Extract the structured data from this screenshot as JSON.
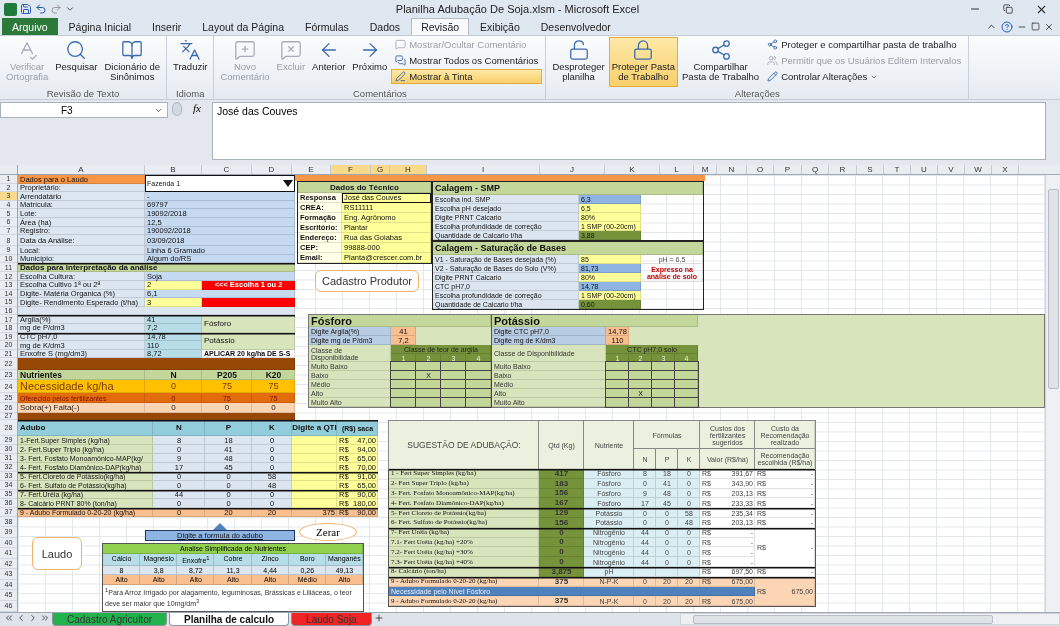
{
  "window": {
    "title": "Planilha Adubação De Soja.xlsm - Microsoft Excel"
  },
  "ribbon_tabs": [
    {
      "label": "Arquivo",
      "kind": "file",
      "selected": false
    },
    {
      "label": "Página Inicial",
      "kind": "tab",
      "selected": false
    },
    {
      "label": "Inserir",
      "kind": "tab",
      "selected": false
    },
    {
      "label": "Layout da Página",
      "kind": "tab",
      "selected": false
    },
    {
      "label": "Fórmulas",
      "kind": "tab",
      "selected": false
    },
    {
      "label": "Dados",
      "kind": "tab",
      "selected": false
    },
    {
      "label": "Revisão",
      "kind": "tab",
      "selected": true
    },
    {
      "label": "Exibição",
      "kind": "tab",
      "selected": false
    },
    {
      "label": "Desenvolvedor",
      "kind": "tab",
      "selected": false
    }
  ],
  "ribbon_groups": [
    {
      "label": "Revisão de Texto",
      "buttons": [
        {
          "label": "Verificar\nOrtografia",
          "disabled": true,
          "selected": false
        },
        {
          "label": "Pesquisar",
          "disabled": false,
          "selected": false
        },
        {
          "label": "Dicionário de\nSinônimos",
          "disabled": false,
          "selected": false
        }
      ]
    },
    {
      "label": "Idioma",
      "buttons": [
        {
          "label": "Traduzir",
          "disabled": false,
          "selected": false
        }
      ]
    },
    {
      "label": "Comentários",
      "buttons": [
        {
          "label": "Novo\nComentário",
          "disabled": true,
          "selected": false
        },
        {
          "label": "Excluir",
          "disabled": true,
          "selected": false
        },
        {
          "label": "Anterior",
          "disabled": false,
          "selected": false
        },
        {
          "label": "Próximo",
          "disabled": false,
          "selected": false
        }
      ],
      "small_buttons": [
        {
          "label": "Mostrar/Ocultar Comentário",
          "disabled": true,
          "selected": false,
          "has_menu": false
        },
        {
          "label": "Mostrar Todos os Comentários",
          "disabled": false,
          "selected": false,
          "has_menu": false
        },
        {
          "label": "Mostrar à Tinta",
          "disabled": false,
          "selected": true,
          "has_menu": false
        }
      ]
    },
    {
      "label": "Alterações",
      "buttons": [
        {
          "label": "Desproteger\nplanilha",
          "disabled": false,
          "selected": false
        },
        {
          "label": "Proteger Pasta\nde Trabalho",
          "disabled": false,
          "selected": true
        },
        {
          "label": "Compartilhar\nPasta de Trabalho",
          "disabled": false,
          "selected": false
        }
      ],
      "small_buttons": [
        {
          "label": "Proteger e compartilhar pasta de trabalho",
          "disabled": false,
          "selected": false,
          "has_menu": false
        },
        {
          "label": "Permitir que os Usuários Editem Intervalos",
          "disabled": true,
          "selected": false,
          "has_menu": false
        },
        {
          "label": "Controlar Alterações",
          "disabled": false,
          "selected": false,
          "has_menu": true
        }
      ]
    }
  ],
  "formula_bar": {
    "name_box": "F3",
    "function_label": "fx",
    "value": "José das Couves"
  },
  "columns": [
    {
      "label": "A",
      "selected": false
    },
    {
      "label": "B",
      "selected": false
    },
    {
      "label": "C",
      "selected": false
    },
    {
      "label": "D",
      "selected": false
    },
    {
      "label": "E",
      "selected": false
    },
    {
      "label": "F",
      "selected": true
    },
    {
      "label": "G",
      "selected": true
    },
    {
      "label": "H",
      "selected": true
    },
    {
      "label": "I",
      "selected": false
    },
    {
      "label": "J",
      "selected": false
    },
    {
      "label": "K",
      "selected": false
    },
    {
      "label": "L",
      "selected": false
    },
    {
      "label": "M",
      "selected": false
    },
    {
      "label": "N",
      "selected": false
    },
    {
      "label": "O",
      "selected": false
    },
    {
      "label": "P",
      "selected": false
    },
    {
      "label": "Q",
      "selected": false
    },
    {
      "label": "R",
      "selected": false
    },
    {
      "label": "S",
      "selected": false
    },
    {
      "label": "T",
      "selected": false
    },
    {
      "label": "U",
      "selected": false
    },
    {
      "label": "V",
      "selected": false
    },
    {
      "label": "W",
      "selected": false
    },
    {
      "label": "X",
      "selected": false
    }
  ],
  "row_numbers": [
    {
      "label": "1",
      "selected": false
    },
    {
      "label": "2",
      "selected": false
    },
    {
      "label": "3",
      "selected": true
    },
    {
      "label": "4",
      "selected": false
    },
    {
      "label": "5",
      "selected": false
    },
    {
      "label": "6",
      "selected": false
    },
    {
      "label": "7",
      "selected": false
    },
    {
      "label": "8",
      "selected": false
    },
    {
      "label": "9",
      "selected": false
    },
    {
      "label": "10",
      "selected": false
    },
    {
      "label": "11",
      "selected": false
    },
    {
      "label": "12",
      "selected": false
    },
    {
      "label": "13",
      "selected": false
    },
    {
      "label": "14",
      "selected": false
    },
    {
      "label": "15",
      "selected": false
    },
    {
      "label": "16",
      "selected": false
    },
    {
      "label": "17",
      "selected": false
    },
    {
      "label": "18",
      "selected": false
    },
    {
      "label": "19",
      "selected": false
    },
    {
      "label": "20",
      "selected": false
    },
    {
      "label": "21",
      "selected": false
    },
    {
      "label": "22",
      "selected": false
    },
    {
      "label": "23",
      "selected": false
    },
    {
      "label": "24",
      "selected": false
    },
    {
      "label": "25",
      "selected": false
    },
    {
      "label": "26",
      "selected": false
    },
    {
      "label": "27",
      "selected": false
    },
    {
      "label": "28",
      "selected": false
    },
    {
      "label": "29",
      "selected": false
    },
    {
      "label": "30",
      "selected": false
    },
    {
      "label": "31",
      "selected": false
    },
    {
      "label": "32",
      "selected": false
    },
    {
      "label": "33",
      "selected": false
    },
    {
      "label": "34",
      "selected": false
    },
    {
      "label": "35",
      "selected": false
    },
    {
      "label": "36",
      "selected": false
    },
    {
      "label": "37",
      "selected": false
    },
    {
      "label": "38",
      "selected": false
    },
    {
      "label": "39",
      "selected": false
    },
    {
      "label": "40",
      "selected": false
    },
    {
      "label": "41",
      "selected": false
    },
    {
      "label": "42",
      "selected": false
    },
    {
      "label": "43",
      "selected": false
    },
    {
      "label": "44",
      "selected": false
    },
    {
      "label": "45",
      "selected": false
    },
    {
      "label": "46",
      "selected": false
    }
  ],
  "laudo": {
    "title": "Dados para o Laudo",
    "dropdown": "Fazenda 1",
    "fields": [
      {
        "label": "Proprietário:"
      },
      {
        "label": "Arrendatário",
        "value": "-"
      },
      {
        "label": "Matrícula:",
        "value": "69797"
      },
      {
        "label": "Lote:",
        "value": "19092/2018"
      },
      {
        "label": "Área (ha)",
        "value": "12,5"
      },
      {
        "label": "Registro:",
        "value": "190092/2018"
      },
      {
        "label": "Data da Análise:",
        "value": "03/09/2018"
      },
      {
        "label": "Local:",
        "value": "Linha 6 Gramado"
      },
      {
        "label": "Município:",
        "value": "Algum do/RS"
      }
    ]
  },
  "interpretation": {
    "title": "Dados para interpretação da análise",
    "inputs": [
      {
        "label": "Escolha Cultura:",
        "value": "Soja",
        "kind": "plain"
      },
      {
        "label": "Escolha Cultivo 1ª ou 2ª",
        "value": "2",
        "kind": "flagged",
        "alert": "<<< Escolha 1 ou 2"
      },
      {
        "label": "Digite- Matéria Organica (%)",
        "value": "6,1",
        "kind": "plain"
      },
      {
        "label": "Digite- Rendimento Esperado (t/ha)",
        "value": "3",
        "kind": "flagged"
      }
    ]
  },
  "soil": {
    "rows": [
      {
        "label": "Argila(%)",
        "value": "41"
      },
      {
        "label": "mg de P/dm3",
        "value": "7,2"
      },
      {
        "label": "CTC pH7,0",
        "value": "14,78"
      },
      {
        "label": "mg de K/dm3",
        "value": "110"
      },
      {
        "label": "Enxofre S (mg/dm3)",
        "value": "8,72"
      }
    ],
    "groups": [
      "Fósforo",
      "Potássio"
    ],
    "note": "APLICAR 20 kg/ha DE S-S"
  },
  "nutrients": {
    "columns": [
      "Nutrientes",
      "N",
      "P205",
      "K20"
    ],
    "rows": [
      {
        "label": "Necessidade kg/ha",
        "values": [
          "0",
          "75",
          "75"
        ],
        "kind": "need"
      },
      {
        "label": "Oferecido pelos fertilizantes",
        "values": [
          "0",
          "75",
          "75"
        ],
        "kind": "offered"
      },
      {
        "label": "Sobra(+) Falta(-)",
        "values": [
          "0",
          "0",
          "0"
        ],
        "kind": "balance"
      }
    ]
  },
  "fertilizers": {
    "columns": [
      "Adubo",
      "N",
      "P",
      "K",
      "Digite a QTI",
      "(R$) saca"
    ],
    "rows": [
      {
        "name": "1-Fert.Super Simples (kg/ha)",
        "n": "8",
        "p": "18",
        "k": "0",
        "currency": "R$",
        "price": "47,00",
        "kind": "phosphate"
      },
      {
        "name": "2- Fert.Super Triplo (kg/ha)",
        "n": "0",
        "p": "41",
        "k": "0",
        "currency": "R$",
        "price": "94,00",
        "kind": "phosphate"
      },
      {
        "name": "3- Fert. Fosfato Monoamônico-MAP(kg/",
        "n": "9",
        "p": "48",
        "k": "0",
        "currency": "R$",
        "price": "65,00",
        "kind": "phosphate"
      },
      {
        "name": "4- Fert. Fosfato Diamônico-DAP(kg/ha)",
        "n": "17",
        "p": "45",
        "k": "0",
        "currency": "R$",
        "price": "70,00",
        "kind": "phosphate"
      },
      {
        "name": "5- Fert.Cloreto de Potássio(kg/ha)",
        "n": "0",
        "p": "0",
        "k": "58",
        "currency": "R$",
        "price": "91,00",
        "kind": "potash"
      },
      {
        "name": "6- Fert. Sulfato de Potássio(kg/ha)",
        "n": "0",
        "p": "0",
        "k": "48",
        "currency": "R$",
        "price": "65,00",
        "kind": "potash"
      },
      {
        "name": "7- Fert.Uréia (kg/ha)",
        "n": "44",
        "p": "0",
        "k": "0",
        "currency": "R$",
        "price": "90,00",
        "kind": "nitrogen"
      },
      {
        "name": "8- Calcário PRNT 80% (ton/ha)",
        "n": "0",
        "p": "0",
        "k": "0",
        "currency": "R$",
        "price": "180,00",
        "kind": "nitrogen"
      },
      {
        "name": "9 - Adubo Formulado  0-20-20 (kg/ha)",
        "n": "0",
        "p": "20",
        "k": "20",
        "qty": "375",
        "currency": "R$",
        "price": "90,00",
        "kind": "formula"
      }
    ]
  },
  "formula_hint": "Digite a formula do adubo",
  "clear_button": "Zerar",
  "report_button": "Laudo",
  "register_button": "Cadastro  Produtor",
  "analysis": {
    "title": "Analise Simplificada de Nutrientes",
    "nutrients": [
      {
        "name": "Cálcio",
        "value": "8",
        "class": "Alto"
      },
      {
        "name": "Magnésio",
        "value": "3,8",
        "class": "Alto"
      },
      {
        "name": "Enxofre$^{1}$",
        "value": "8,72",
        "class": "Alto"
      },
      {
        "name": "Cobre",
        "value": "11,3",
        "class": "Alto"
      },
      {
        "name": "Zinco",
        "value": "4,44",
        "class": "Alto"
      },
      {
        "name": "Boro",
        "value": "0,26",
        "class": "Médio"
      },
      {
        "name": "Manganês",
        "value": "49,13",
        "class": "Alto"
      }
    ],
    "footnote": "$^{1}$Para Arroz Irrigado por alagamento, leguminosas, Brássicas e Liliáceas, o teor deve ser maior que 10mg/dm$^{3}$"
  },
  "technician": {
    "title": "Dados do Técnico",
    "fields": [
      {
        "label": "Responsa",
        "value": "José das Couves",
        "selected": true
      },
      {
        "label": "CREA:",
        "value": "RS11111",
        "selected": false
      },
      {
        "label": "Formação",
        "value": "Eng. Agrônomo",
        "selected": false
      },
      {
        "label": "Escritório:",
        "value": "Plantar",
        "selected": false
      },
      {
        "label": "Endereço:",
        "value": "Rua das Goiabas",
        "selected": false
      },
      {
        "label": "CEP:",
        "value": "99888-000",
        "selected": false
      },
      {
        "label": "Email:",
        "value": "Planta@crescer.com.br",
        "selected": false
      }
    ]
  },
  "liming_smp": {
    "title": "Calagem - SMP",
    "rows": [
      {
        "label": "Escolha ind. SMP",
        "value": "6,3",
        "kind": "calc"
      },
      {
        "label": "Escolha pH desejado",
        "value": "6,5",
        "kind": "input"
      },
      {
        "label": "Digite PRNT Calcario",
        "value": "80%",
        "kind": "input"
      },
      {
        "label": "Escolha profundidade de correção",
        "value": "1 SMP   (00-20cm)",
        "kind": "input"
      },
      {
        "label": "Quantidade de Calcario t/ha",
        "value": "3,88",
        "kind": "result"
      }
    ]
  },
  "liming_bases": {
    "title": "Calagem - Saturação de Bases",
    "rows": [
      {
        "label": "V1 - Saturação de Bases desejada (%)",
        "value": "85",
        "kind": "input"
      },
      {
        "label": "V2 - Saturação de Bases do Solo (V%)",
        "value": "81,73",
        "kind": "calc"
      },
      {
        "label": "Digite PRNT Calcario",
        "value": "80%",
        "kind": "input"
      },
      {
        "label": "CTC pH7,0",
        "value": "14,78",
        "kind": "calc"
      },
      {
        "label": "Escolha profundidade de correção",
        "value": "1 SMP   (00-20cm)",
        "kind": "input"
      },
      {
        "label": "Quantidade de Calcario t/ha",
        "value": "0,60",
        "kind": "result"
      }
    ],
    "ph_note": "pH = 6,5",
    "warning": "Expresso na análise de solo"
  },
  "availability": [
    {
      "title": "Fósforo",
      "inputs": [
        {
          "label": "Digite Argila(%)",
          "value": "41"
        },
        {
          "label": "Digite mg de P/dm3",
          "value": "7,2"
        }
      ],
      "class_label": "Classe de Disponibilidade",
      "scale_title": "Classe de teor de argila",
      "scale": [
        "1",
        "2",
        "3",
        "4"
      ],
      "mark_symbol": "X",
      "levels": [
        {
          "label": "Muito Baixo",
          "marked": [
            false,
            false,
            false,
            false
          ]
        },
        {
          "label": "Baixo",
          "marked": [
            false,
            true,
            false,
            false
          ]
        },
        {
          "label": "Médio",
          "marked": [
            false,
            false,
            false,
            false
          ]
        },
        {
          "label": "Alto",
          "marked": [
            false,
            false,
            false,
            false
          ]
        },
        {
          "label": "Muito Alto",
          "marked": [
            false,
            false,
            false,
            false
          ]
        }
      ]
    },
    {
      "title": "Potássio",
      "inputs": [
        {
          "label": "Digite CTC pH7,0",
          "value": "14,78"
        },
        {
          "label": "Digite mg de K/dm3",
          "value": "110"
        }
      ],
      "class_label": "Classe de Disponibilidade",
      "scale_title": "CTC pH7,0 solo",
      "scale": [
        "1",
        "2",
        "3",
        "4"
      ],
      "mark_symbol": "X",
      "levels": [
        {
          "label": "Muito Baixo",
          "marked": [
            false,
            false,
            false,
            false
          ]
        },
        {
          "label": "Baixo",
          "marked": [
            false,
            false,
            false,
            false
          ]
        },
        {
          "label": "Médio",
          "marked": [
            false,
            false,
            false,
            false
          ]
        },
        {
          "label": "Alto",
          "marked": [
            false,
            true,
            false,
            false
          ]
        },
        {
          "label": "Muito Alto",
          "marked": [
            false,
            false,
            false,
            false
          ]
        }
      ]
    }
  ],
  "suggestion": {
    "title": "SUGESTÃO DE ADUBAÇÃO:",
    "qty_header": "Qtd (Kg)",
    "nutrient_header": "Nutriente",
    "formulas_header": "Fórmulas",
    "formula_columns": [
      "N",
      "P",
      "K"
    ],
    "cost_header": "Custos dos fertilizantes sugeridos",
    "cost_subheader": "Valor (R$/ha)",
    "rec_header": "Custo da Recomendação realizado",
    "rec_subheader": "Recomendação escolhida (R$/ha)",
    "groups": [
      {
        "kind": "phosphate",
        "rows": [
          {
            "name": "1 - Fert Super Simples (kg/ha)",
            "qty": "417",
            "nutrient": "Fósforo",
            "n": "8",
            "p": "18",
            "k": "0",
            "cost": [
              "R$",
              "391,67"
            ],
            "rec": [
              "R$",
              "-"
            ]
          },
          {
            "name": "2- Fert Super Triplo (kg/ha)",
            "qty": "183",
            "nutrient": "Fósforo",
            "n": "0",
            "p": "41",
            "k": "0",
            "cost": [
              "R$",
              "343,90"
            ],
            "rec": [
              "R$",
              "-"
            ]
          },
          {
            "name": "3- Fert. Fosfato Monoamônico-MAP(kg/ha)",
            "qty": "156",
            "nutrient": "Fósforo",
            "n": "9",
            "p": "48",
            "k": "0",
            "cost": [
              "R$",
              "203,13"
            ],
            "rec": [
              "R$",
              "-"
            ]
          },
          {
            "name": "4- Fert. Fosfato Diamônico-DAP(kg/ha)",
            "qty": "167",
            "nutrient": "Fósforo",
            "n": "17",
            "p": "45",
            "k": "0",
            "cost": [
              "R$",
              "233,33"
            ],
            "rec": [
              "R$",
              "-"
            ]
          }
        ]
      },
      {
        "kind": "potash",
        "rows": [
          {
            "name": "5- Fert Cloreto de Potássio(kg/ha)",
            "qty": "129",
            "nutrient": "Potássio",
            "n": "0",
            "p": "0",
            "k": "58",
            "cost": [
              "R$",
              "235,34"
            ],
            "rec": [
              "R$",
              "-"
            ]
          },
          {
            "name": "6- Fert. Sulfato de Potássio(kg/ha)",
            "qty": "156",
            "nutrient": "Potássio",
            "n": "0",
            "p": "0",
            "k": "48",
            "cost": [
              "R$",
              "203,13"
            ],
            "rec": [
              "R$",
              "-"
            ]
          }
        ]
      },
      {
        "kind": "nitrogen",
        "rec": [
          "R$",
          "-"
        ],
        "rows": [
          {
            "name": "7- Fert Uréia (kg/ha)",
            "qty": "0",
            "nutrient": "Nitrogênio",
            "n": "44",
            "p": "0",
            "k": "0",
            "cost": [
              "R$",
              "-"
            ]
          },
          {
            "name": "7.1- Fert Uréia (kg/ha) +20%",
            "qty": "0",
            "nutrient": "Nitrogênio",
            "n": "44",
            "p": "0",
            "k": "0",
            "cost": [
              "R$",
              "-"
            ]
          },
          {
            "name": "7.2- Fert Uréia (kg/ha) +30%",
            "qty": "0",
            "nutrient": "Nitrogênio",
            "n": "44",
            "p": "0",
            "k": "0",
            "cost": [
              "R$",
              "-"
            ]
          },
          {
            "name": "7.3- Fert Uréia (kg/ha) +40%",
            "qty": "0",
            "nutrient": "Nitrogênio",
            "n": "44",
            "p": "0",
            "k": "0",
            "cost": [
              "R$",
              "-"
            ]
          }
        ]
      },
      {
        "kind": "lime",
        "rows": [
          {
            "name": "8- Calcário (ton/ha)",
            "qty": "3,875",
            "nutrient": "pH",
            "cost": [
              "R$",
              "697,50"
            ],
            "rec": [
              "R$",
              "-"
            ]
          }
        ]
      },
      {
        "kind": "formula",
        "rec": [
          "R$",
          "675,00"
        ],
        "rows": [
          {
            "name": "9 - Adubo Formulado  0-20-20 (kg/ha)",
            "qty": "375",
            "nutrient": "N-P-K",
            "n": "0",
            "p": "20",
            "k": "20",
            "cost": [
              "R$",
              "675,00"
            ]
          },
          {
            "note": "Necessidade pelo Nível Fósforo"
          },
          {
            "name": "9 - Adubo Formulado  0-20-20 (kg/ha)",
            "qty": "375",
            "nutrient": "N-P-K",
            "n": "0",
            "p": "20",
            "k": "20",
            "cost": [
              "R$",
              "675,00"
            ]
          }
        ]
      }
    ]
  },
  "sheet_tabs": [
    {
      "label": "Cadastro Agricultor",
      "selected": false,
      "color": "#21b24b"
    },
    {
      "label": "Planilha de calculo",
      "selected": true,
      "color": "#ffffff"
    },
    {
      "label": "Laudo Soja",
      "selected": false,
      "color": "#f02424"
    }
  ]
}
